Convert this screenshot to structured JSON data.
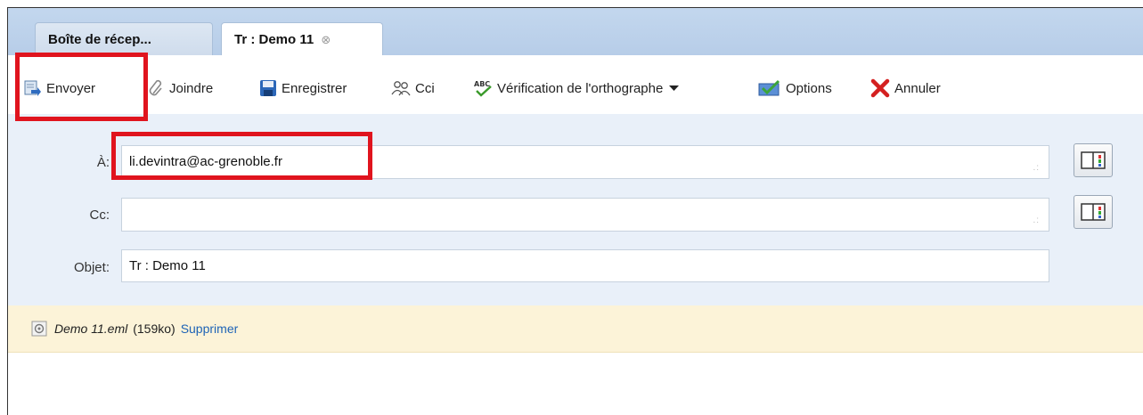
{
  "tabs": [
    {
      "label": "Boîte de récep..."
    },
    {
      "label": "Tr : Demo 11",
      "close": "⊗"
    }
  ],
  "toolbar": {
    "send": "Envoyer",
    "attach": "Joindre",
    "save": "Enregistrer",
    "bcc": "Cci",
    "spell": "Vérification de l'orthographe",
    "options": "Options",
    "cancel": "Annuler"
  },
  "form": {
    "to_label": "À:",
    "to_value": "li.devintra@ac-grenoble.fr",
    "cc_label": "Cc:",
    "cc_value": "",
    "subject_label": "Objet:",
    "subject_value": "Tr : Demo 11"
  },
  "attachment": {
    "name": "Demo 11.eml",
    "size": "(159ko)",
    "remove": "Supprimer"
  },
  "colors": {
    "highlight": "#e0141e",
    "link": "#1e63b6",
    "tabbar": "#b7cde8",
    "header_bg": "#e9f0f9",
    "attach_bg": "#fcf3d8"
  }
}
